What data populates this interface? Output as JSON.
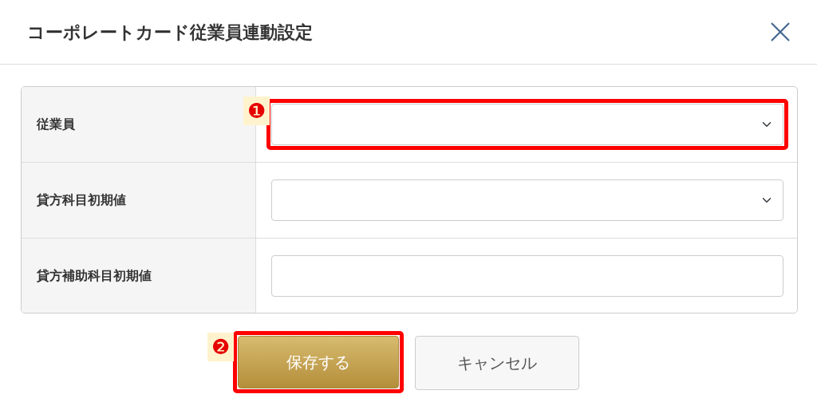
{
  "dialog": {
    "title": "コーポレートカード従業員連動設定"
  },
  "fields": [
    {
      "label": "従業員",
      "kind": "select",
      "highlighted": true,
      "marker": "❶"
    },
    {
      "label": "貸方科目初期値",
      "kind": "select",
      "highlighted": false
    },
    {
      "label": "貸方補助科目初期値",
      "kind": "text",
      "highlighted": false
    }
  ],
  "buttons": [
    {
      "label": "保存する",
      "kind": "primary",
      "highlighted": true,
      "marker": "❷"
    },
    {
      "label": "キャンセル",
      "kind": "secondary",
      "highlighted": false
    }
  ]
}
